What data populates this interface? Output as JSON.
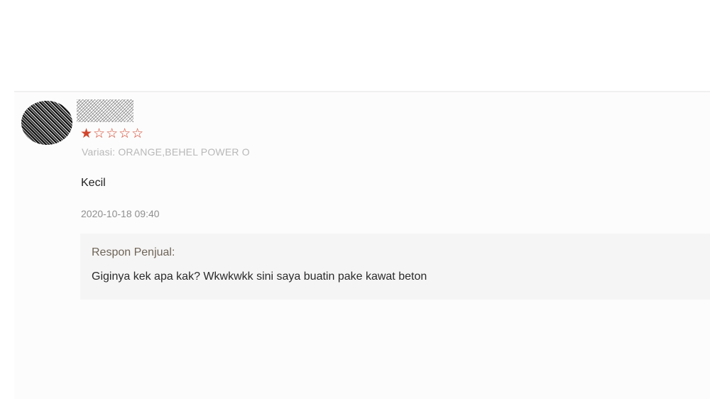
{
  "review": {
    "username": "",
    "rating": 1,
    "rating_max": 5,
    "stars": {
      "filled": "★",
      "empty": "☆☆☆☆"
    },
    "variation_text": "Variasi: ORANGE,BEHEL POWER O",
    "comment": "Kecil",
    "timestamp": "2020-10-18 09:40",
    "seller_response": {
      "title": "Respon Penjual:",
      "text": "Giginya kek apa kak? Wkwkwkk sini saya buatin pake kawat beton"
    }
  },
  "colors": {
    "star": "#d0462d",
    "response_bg": "#f6f5f5",
    "response_title": "#6e6458"
  }
}
